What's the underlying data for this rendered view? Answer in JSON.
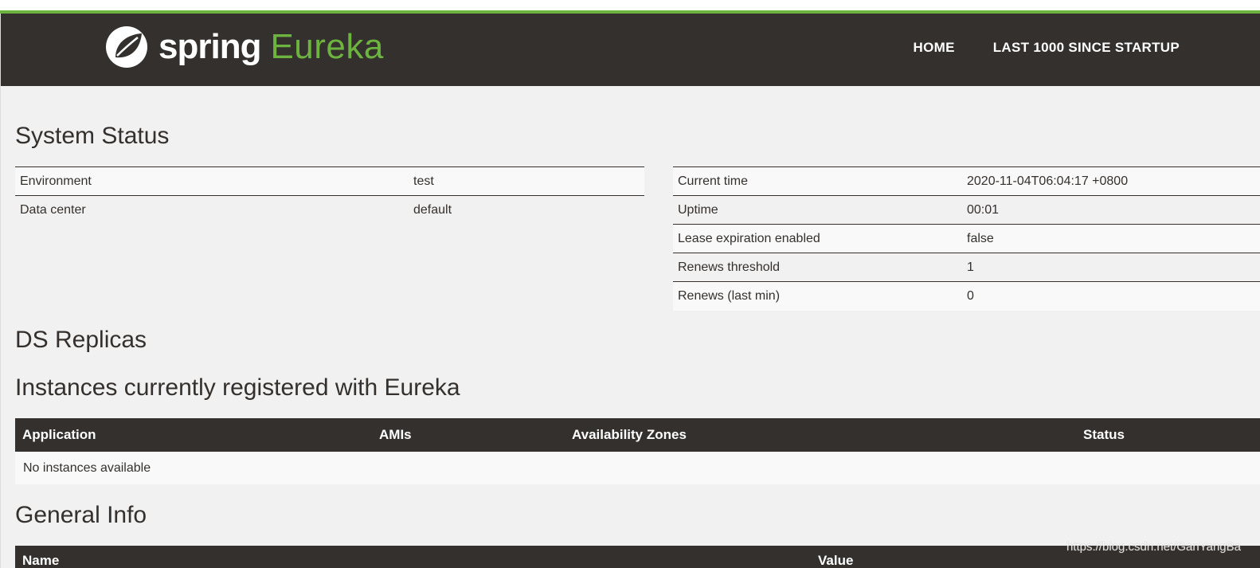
{
  "nav": {
    "logo_spring": "spring",
    "logo_eureka": "Eureka",
    "links": [
      "HOME",
      "LAST 1000 SINCE STARTUP"
    ]
  },
  "system_status": {
    "title": "System Status",
    "left": [
      {
        "key": "Environment",
        "value": "test"
      },
      {
        "key": "Data center",
        "value": "default"
      }
    ],
    "right": [
      {
        "key": "Current time",
        "value": "2020-11-04T06:04:17 +0800"
      },
      {
        "key": "Uptime",
        "value": "00:01"
      },
      {
        "key": "Lease expiration enabled",
        "value": "false"
      },
      {
        "key": "Renews threshold",
        "value": "1"
      },
      {
        "key": "Renews (last min)",
        "value": "0"
      }
    ]
  },
  "ds_replicas": {
    "title": "DS Replicas"
  },
  "instances": {
    "title": "Instances currently registered with Eureka",
    "headers": [
      "Application",
      "AMIs",
      "Availability Zones",
      "Status"
    ],
    "empty_message": "No instances available"
  },
  "general_info": {
    "title": "General Info",
    "headers": [
      "Name",
      "Value"
    ]
  },
  "watermark": "https://blog.csdn.net/GanYangBa",
  "colors": {
    "brand_green": "#6db33f",
    "dark": "#34302d",
    "background": "#f1f1f1"
  }
}
